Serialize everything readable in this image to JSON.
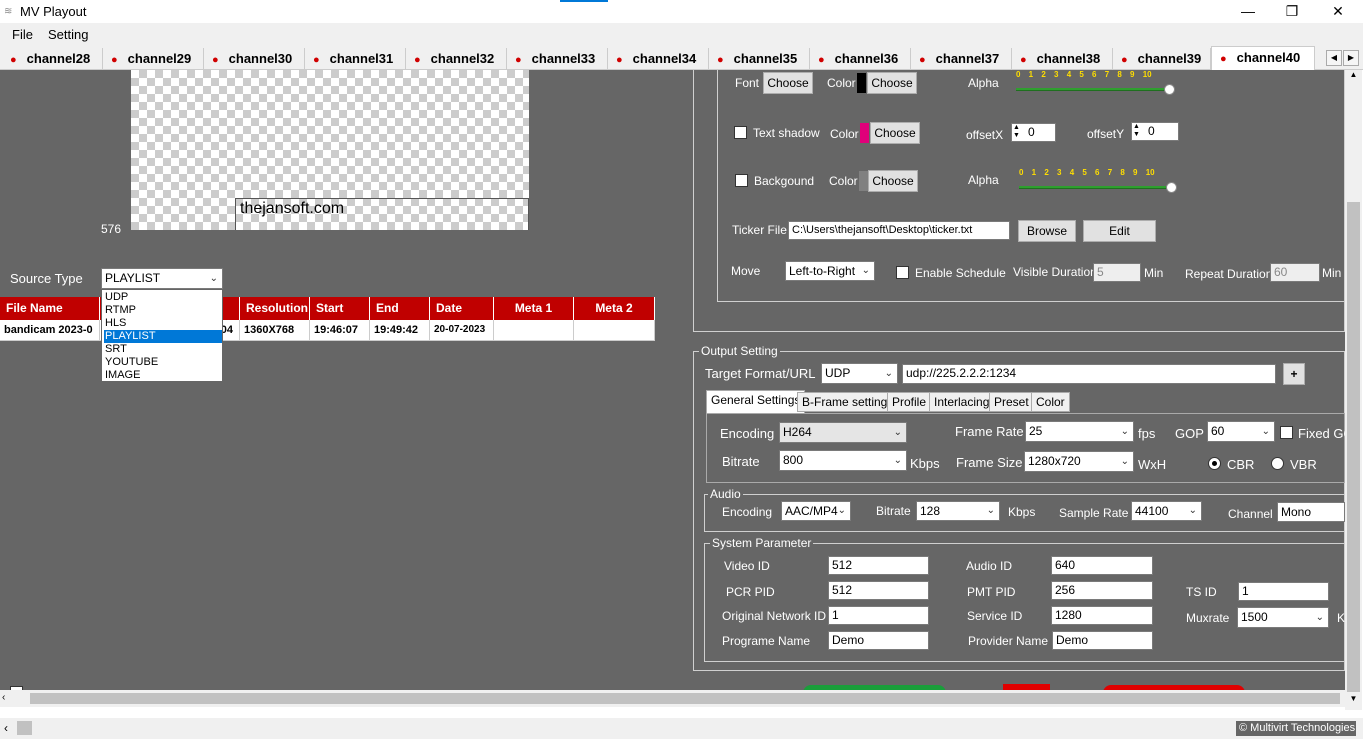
{
  "window": {
    "title": "MV Playout",
    "minimize": "—",
    "maximize": "❐",
    "close": "✕"
  },
  "menu": [
    "File",
    "Setting"
  ],
  "tabs": [
    "channel28",
    "channel29",
    "channel30",
    "channel31",
    "channel32",
    "channel33",
    "channel34",
    "channel35",
    "channel36",
    "channel37",
    "channel38",
    "channel39",
    "channel40"
  ],
  "active_tab": "channel40",
  "preview": {
    "overlay_text": "thejansoft.com",
    "height_label": "576"
  },
  "source": {
    "label": "Source Type",
    "selected": "PLAYLIST",
    "options": [
      "UDP",
      "RTMP",
      "HLS",
      "PLAYLIST",
      "SRT",
      "YOUTUBE",
      "IMAGE"
    ]
  },
  "playlist_table": {
    "headers": [
      "File Name",
      "",
      "Resolution",
      "Start",
      "End",
      "Date",
      "Meta 1",
      "Meta 2"
    ],
    "rows": [
      [
        "bandicam 2023-0",
        "04",
        "1360X768",
        "19:46:07",
        "19:49:42",
        "20-07-2023",
        "",
        ""
      ]
    ]
  },
  "ticker": {
    "font_label": "Font",
    "choose": "Choose",
    "color_label": "Color",
    "alpha_label": "Alpha",
    "ticks": "0 1 2 3 4 5 6 7 8 9 10",
    "text_shadow_label": "Text shadow",
    "offsetx_label": "offsetX",
    "offsetx_value": "0",
    "offsety_label": "offsetY",
    "offsety_value": "0",
    "background_label": "Backgound",
    "ticker_file_label": "Ticker File",
    "ticker_file_value": "C:\\Users\\thejansoft\\Desktop\\ticker.txt",
    "browse": "Browse",
    "edit": "Edit",
    "move_label": "Move",
    "move_value": "Left-to-Right",
    "enable_schedule": "Enable Schedule",
    "visible_duration_label": "Visible Duration",
    "visible_duration_value": "5",
    "min": "Min",
    "repeat_duration_label": "Repeat Duration",
    "repeat_duration_value": "60",
    "font_color": "#000000",
    "shadow_color": "#e0007a",
    "bg_color": "#808080"
  },
  "output": {
    "title": "Output Setting",
    "target_label": "Target Format/URL",
    "target_format": "UDP",
    "target_url": "udp://225.2.2.2:1234",
    "add": "+",
    "subtabs": [
      "General Settings",
      "B-Frame settings",
      "Profile",
      "Interlacing",
      "Preset",
      "Color"
    ],
    "encoding_label": "Encoding",
    "encoding_value": "H264",
    "framerate_label": "Frame Rate",
    "framerate_value": "25",
    "fps": "fps",
    "gop_label": "GOP",
    "gop_value": "60",
    "fixed_gop": "Fixed GO",
    "bitrate_label": "Bitrate",
    "bitrate_value": "800",
    "kbps": "Kbps",
    "framesize_label": "Frame Size",
    "framesize_value": "1280x720",
    "wxh": "WxH",
    "cbr": "CBR",
    "vbr": "VBR"
  },
  "audio": {
    "title": "Audio",
    "encoding_label": "Encoding",
    "encoding_value": "AAC/MP4",
    "bitrate_label": "Bitrate",
    "bitrate_value": "128",
    "kbps": "Kbps",
    "samplerate_label": "Sample Rate",
    "samplerate_value": "44100",
    "channel_label": "Channel",
    "channel_value": "Mono"
  },
  "system": {
    "title": "System Parameter",
    "video_id_label": "Video ID",
    "video_id": "512",
    "audio_id_label": "Audio ID",
    "audio_id": "640",
    "pcr_pid_label": "PCR PID",
    "pcr_pid": "512",
    "pmt_pid_label": "PMT PID",
    "pmt_pid": "256",
    "ts_id_label": "TS ID",
    "ts_id": "1",
    "onid_label": "Original Network ID",
    "onid": "1",
    "service_id_label": "Service ID",
    "service_id": "1280",
    "muxrate_label": "Muxrate",
    "muxrate": "1500",
    "muxrate_unit": "K",
    "program_name_label": "Programe Name",
    "program_name": "Demo",
    "provider_name_label": "Provider Name",
    "provider_name": "Demo"
  },
  "status": {
    "copyright": "© Multivirt Technologies"
  }
}
